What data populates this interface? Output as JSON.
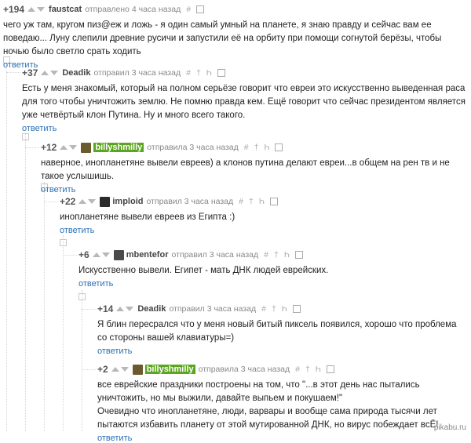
{
  "comments": [
    {
      "rating": "+194",
      "user": "faustcat",
      "highlight": false,
      "meta": "отправлено 4 часа назад",
      "actions": [
        "#"
      ],
      "text": "чего уж там, кругом пиз@еж и ложь - я один самый умный на планете, я знаю правду и сейчас вам ее поведаю... Луну слепили древние русичи и запустили её на орбиту при помощи согнутой берёзы, чтобы ночью было светло срать ходить",
      "reply": "ответить"
    },
    {
      "rating": "+37",
      "user": "Deadik",
      "highlight": false,
      "meta": "отправил 3 часа назад",
      "actions": [
        "#",
        "†",
        "Һ"
      ],
      "text": "Есть у меня знакомый, который на полном серьёзе говорит что евреи это искусственно выведенная раса для того чтобы уничтожить землю. Не помню правда кем. Ещё говорит что сейчас президентом является уже четвёртый клон Путина. Ну и много всего такого.",
      "reply": "ответить"
    },
    {
      "rating": "+12",
      "user": "billyshmilly",
      "highlight": true,
      "meta": "отправила 3 часа назад",
      "actions": [
        "#",
        "†",
        "Һ"
      ],
      "text": "наверное, инопланетяне вывели евреев) а клонов путина делают евреи...в общем на рен тв и не такое услышишь.",
      "reply": "ответить"
    },
    {
      "rating": "+22",
      "user": "imploid",
      "highlight": false,
      "meta": "отправил 3 часа назад",
      "actions": [
        "#",
        "†",
        "Һ"
      ],
      "text": "инопланетяне вывели евреев из Египта :)",
      "reply": "ответить"
    },
    {
      "rating": "+6",
      "user": "mbentefor",
      "highlight": false,
      "meta": "отправил 3 часа назад",
      "actions": [
        "#",
        "†",
        "Һ"
      ],
      "text": "Искусственно вывели. Египет - мать ДНК людей еврейских.",
      "reply": "ответить"
    },
    {
      "rating": "+14",
      "user": "Deadik",
      "highlight": false,
      "meta": "отправил 3 часа назад",
      "actions": [
        "#",
        "†",
        "Һ"
      ],
      "text": "Я блин пересрался что у меня новый битый пиксель появился, хорошо что проблема со стороны вашей клавиатуры=)",
      "reply": "ответить"
    },
    {
      "rating": "+2",
      "user": "billyshmilly",
      "highlight": true,
      "meta": "отправила 3 часа назад",
      "actions": [
        "#",
        "†",
        "Һ"
      ],
      "text": " все еврейские праздники построены на том, что \"...в этот день нас пытались уничтожить, но мы выжили, давайте выпьем и покушаем!\"\nОчевидно что инопланетяне, люди, варвары и вообще сама природа тысячи лет пытаются избавить планету от этой мутированной ДНК, но вирус побеждает всЁ!",
      "reply": "ответить"
    }
  ],
  "watermark": "pikabu.ru",
  "colors": {
    "link": "#2a6fb5",
    "highlight_bg": "#5aa61e",
    "text": "#222222",
    "meta": "#888888"
  }
}
